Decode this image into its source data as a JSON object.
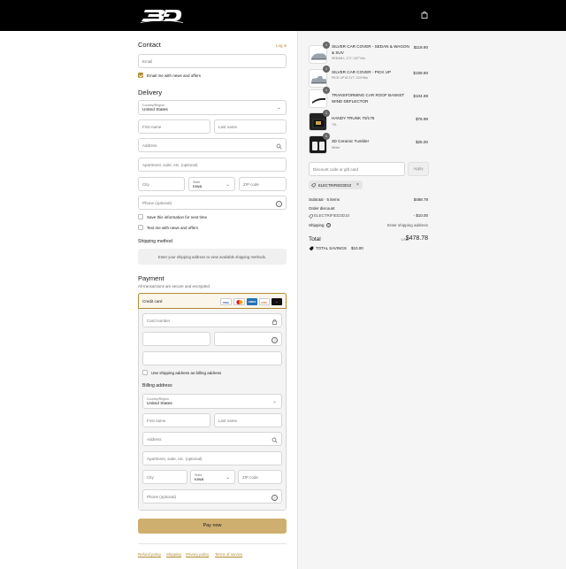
{
  "header": {
    "logo_icon": "3d-logo",
    "cart_icon": "shopping-bag-icon"
  },
  "contact": {
    "title": "Contact",
    "login_link": "Log in",
    "email_placeholder": "Email",
    "email_news_label": "Email me with news and offers",
    "email_news_checked": true
  },
  "delivery": {
    "title": "Delivery",
    "country_label": "Country/Region",
    "country_value": "United States",
    "first_name": "First name",
    "last_name": "Last name",
    "address": "Address",
    "apartment": "Apartment, suite, etc. (optional)",
    "city": "City",
    "state_label": "State",
    "state_value": "Iowa",
    "zip": "ZIP code",
    "phone": "Phone (optional)",
    "save_info_label": "Save this information for next time",
    "text_news_label": "Text me with news and offers"
  },
  "shipping_method": {
    "title": "Shipping method",
    "notice": "Enter your shipping address to view available shipping methods."
  },
  "payment": {
    "title": "Payment",
    "subtitle": "All transactions are secure and encrypted.",
    "method_label": "Credit card",
    "card_brands": [
      "VISA",
      "MC",
      "AMEX",
      "DISC",
      "..."
    ],
    "card_number": "Card number",
    "use_shipping_label": "Use shipping address as billing address",
    "billing_title": "Billing address",
    "billing_country_label": "Country/Region",
    "billing_country_value": "United States",
    "billing_first": "First name",
    "billing_last": "Last name",
    "billing_address": "Address",
    "billing_apartment": "Apartment, suite, etc. (optional)",
    "billing_city": "City",
    "billing_state_label": "State",
    "billing_state_value": "Iowa",
    "billing_zip": "ZIP code",
    "billing_phone": "Phone (optional)",
    "pay_button": "Pay now"
  },
  "footer": {
    "links": [
      "Refund policy",
      "Shipping",
      "Privacy policy",
      "Terms of service"
    ]
  },
  "order": {
    "items": [
      {
        "name": "SILVER CAR COVER - SEDAN & WAGON & SUV",
        "variant": "SEDAN L 171\"-187\"/4m",
        "price": "$119.90",
        "qty": "1"
      },
      {
        "name": "SILVER CAR COVER - PICK UP",
        "variant": "PICK UP M 217\"-224\"/6m",
        "price": "$159.90",
        "qty": "1"
      },
      {
        "name": "TRANSFORMING CAR ROOF BASKET WIND DEFLECTOR",
        "variant": "",
        "price": "$104.99",
        "qty": "1"
      },
      {
        "name": "HANDY TRUNK 70/175",
        "variant": "70L",
        "price": "$78.99",
        "qty": "1"
      },
      {
        "name": "3D Ceramic Tumbler",
        "variant": "White",
        "price": "$25.00",
        "qty": "1"
      }
    ],
    "discount_placeholder": "Discount code or gift card",
    "apply_label": "Apply",
    "applied_code": "ELECTRIFIED3D10",
    "subtotal_label": "Subtotal · 5 items",
    "subtotal_value": "$488.78",
    "order_discount_label": "Order discount",
    "order_discount_code": "ELECTRIFIED3D10",
    "order_discount_value": "- $10.00",
    "shipping_label": "Shipping",
    "shipping_value": "Enter shipping address",
    "total_label": "Total",
    "currency": "USD",
    "total_value": "$478.78",
    "savings_label": "TOTAL SAVINGS",
    "savings_value": "$10.00"
  },
  "colors": {
    "accent": "#b48a2e",
    "pay_button": "#cfaf6f",
    "header": "#000000",
    "summary_bg": "#f5f5f5"
  }
}
